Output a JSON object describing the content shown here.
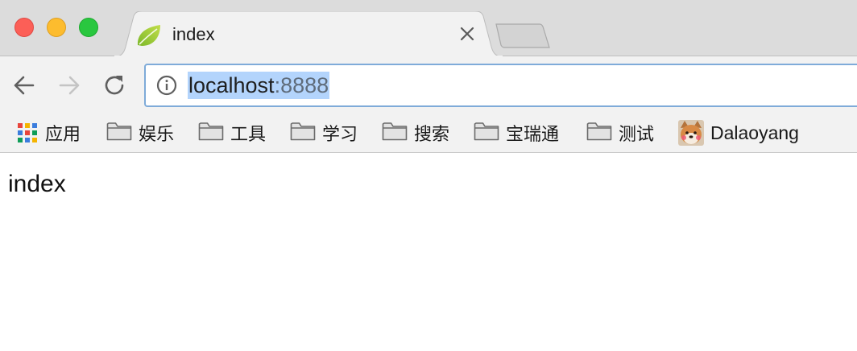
{
  "window": {
    "controls": {
      "close_color": "#fc5f57",
      "minimize_color": "#fdbc2e",
      "maximize_color": "#29c73f"
    }
  },
  "tab": {
    "title": "index",
    "favicon": "spring-leaf-icon",
    "close_icon": "close-icon"
  },
  "new_tab": {
    "icon": "new-tab-icon"
  },
  "toolbar": {
    "back_icon": "back-arrow-icon",
    "forward_icon": "forward-arrow-icon",
    "reload_icon": "reload-icon",
    "forward_enabled": false
  },
  "omnibox": {
    "info_icon": "info-icon",
    "url_host": "localhost",
    "url_port": ":8888",
    "selection_color": "#b3d4fc"
  },
  "bookmarks": {
    "apps_label": "应用",
    "items": [
      {
        "label": "娱乐",
        "icon": "folder-icon"
      },
      {
        "label": "工具",
        "icon": "folder-icon"
      },
      {
        "label": "学习",
        "icon": "folder-icon"
      },
      {
        "label": "搜索",
        "icon": "folder-icon"
      },
      {
        "label": "宝瑞通",
        "icon": "folder-icon"
      },
      {
        "label": "测试",
        "icon": "folder-icon"
      }
    ],
    "profile": {
      "label": "Dalaoyang",
      "icon": "shiba-avatar-icon"
    }
  },
  "page": {
    "body_text": "index"
  }
}
